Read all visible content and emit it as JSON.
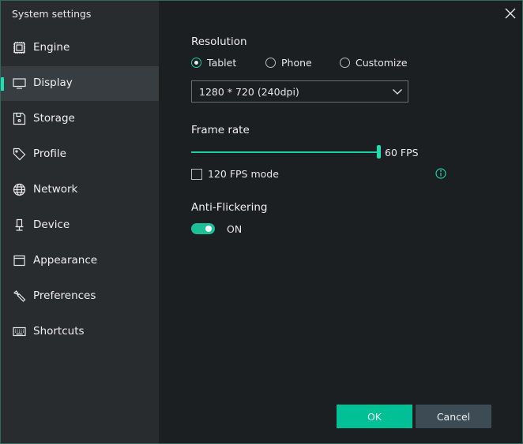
{
  "window": {
    "title": "System settings",
    "close_icon": "close-icon"
  },
  "sidebar": {
    "active": "Display",
    "items": [
      {
        "label": "Engine",
        "icon": "cpu-chip-icon"
      },
      {
        "label": "Display",
        "icon": "monitor-icon"
      },
      {
        "label": "Storage",
        "icon": "floppy-disk-icon"
      },
      {
        "label": "Profile",
        "icon": "tag-icon"
      },
      {
        "label": "Network",
        "icon": "globe-icon"
      },
      {
        "label": "Device",
        "icon": "device-stand-icon"
      },
      {
        "label": "Appearance",
        "icon": "window-icon"
      },
      {
        "label": "Preferences",
        "icon": "wrench-icon"
      },
      {
        "label": "Shortcuts",
        "icon": "keyboard-icon"
      }
    ]
  },
  "display": {
    "resolution": {
      "title": "Resolution",
      "options": [
        "Tablet",
        "Phone",
        "Customize"
      ],
      "selected": "Tablet",
      "dropdown_value": "1280 * 720 (240dpi)"
    },
    "frame_rate": {
      "title": "Frame rate",
      "value_label": "60 FPS",
      "slider_fraction": 1.0,
      "fps120_label": "120 FPS mode",
      "fps120_checked": false
    },
    "anti_flickering": {
      "title": "Anti-Flickering",
      "state_label": "ON",
      "enabled": true
    }
  },
  "buttons": {
    "ok": "OK",
    "cancel": "Cancel"
  },
  "colors": {
    "accent": "#1ccfa3",
    "ok_button": "#00c095",
    "cancel_button": "#3c4b54"
  }
}
